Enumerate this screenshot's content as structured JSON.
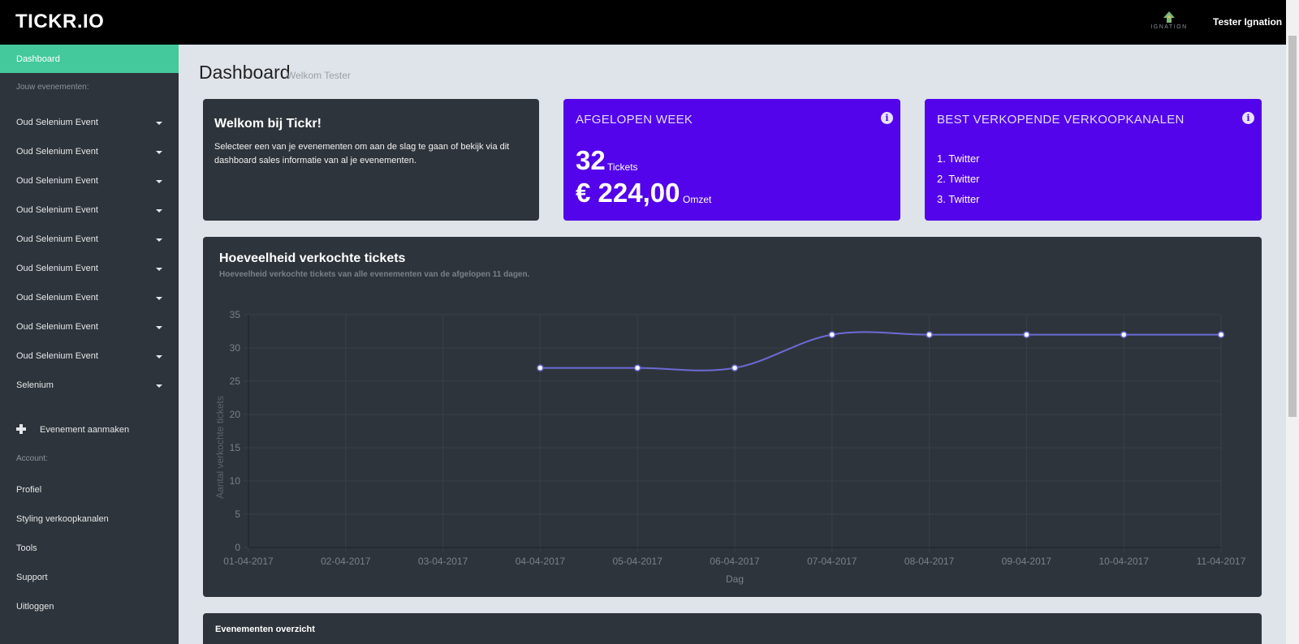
{
  "header": {
    "logo": "TICKR.IO",
    "brand_text": "IGNATION",
    "user": "Tester Ignation"
  },
  "sidebar": {
    "active": "Dashboard",
    "events_label": "Jouw evenementen:",
    "events": [
      "Oud Selenium Event",
      "Oud Selenium Event",
      "Oud Selenium Event",
      "Oud Selenium Event",
      "Oud Selenium Event",
      "Oud Selenium Event",
      "Oud Selenium Event",
      "Oud Selenium Event",
      "Oud Selenium Event",
      "Selenium"
    ],
    "create_event": "Evenement aanmaken",
    "account_label": "Account:",
    "account_items": [
      "Profiel",
      "Styling verkoopkanalen",
      "Tools",
      "Support",
      "Uitloggen"
    ]
  },
  "page": {
    "title": "Dashboard",
    "subtitle": "Welkom Tester"
  },
  "welcome": {
    "title": "Welkom bij Tickr!",
    "text": "Selecteer een van je evenementen om aan de slag te gaan of bekijk via dit dashboard sales informatie van al je evenementen."
  },
  "week": {
    "title": "AFGELOPEN WEEK",
    "tickets": "32",
    "tickets_label": "Tickets",
    "revenue": "€ 224,00",
    "revenue_label": "Omzet"
  },
  "channels": {
    "title": "BEST VERKOPENDE VERKOOPKANALEN",
    "items": [
      "1. Twitter",
      "2. Twitter",
      "3. Twitter"
    ]
  },
  "chart_section": {
    "title": "Hoeveelheid verkochte tickets",
    "subtitle": "Hoeveelheid verkochte tickets van alle evenementen van de afgelopen 11 dagen."
  },
  "chart_data": {
    "type": "line",
    "x": [
      "01-04-2017",
      "02-04-2017",
      "03-04-2017",
      "04-04-2017",
      "05-04-2017",
      "06-04-2017",
      "07-04-2017",
      "08-04-2017",
      "09-04-2017",
      "10-04-2017",
      "11-04-2017"
    ],
    "series": [
      {
        "values": [
          null,
          null,
          null,
          27,
          27,
          27,
          32,
          32,
          32,
          32,
          32
        ],
        "color": "#6b6bd6"
      }
    ],
    "xlabel": "Dag",
    "ylabel": "Aantal verkochte tickets",
    "ylim": [
      0,
      35
    ],
    "yticks": [
      0,
      5,
      10,
      15,
      20,
      25,
      30,
      35
    ],
    "grid": true,
    "smooth": true
  },
  "events_overview": {
    "title": "Evenementen overzicht"
  },
  "colors": {
    "accent": "#44c99c",
    "purple": "#5304ea",
    "dark": "#2e343b",
    "topbar": "#000000"
  }
}
